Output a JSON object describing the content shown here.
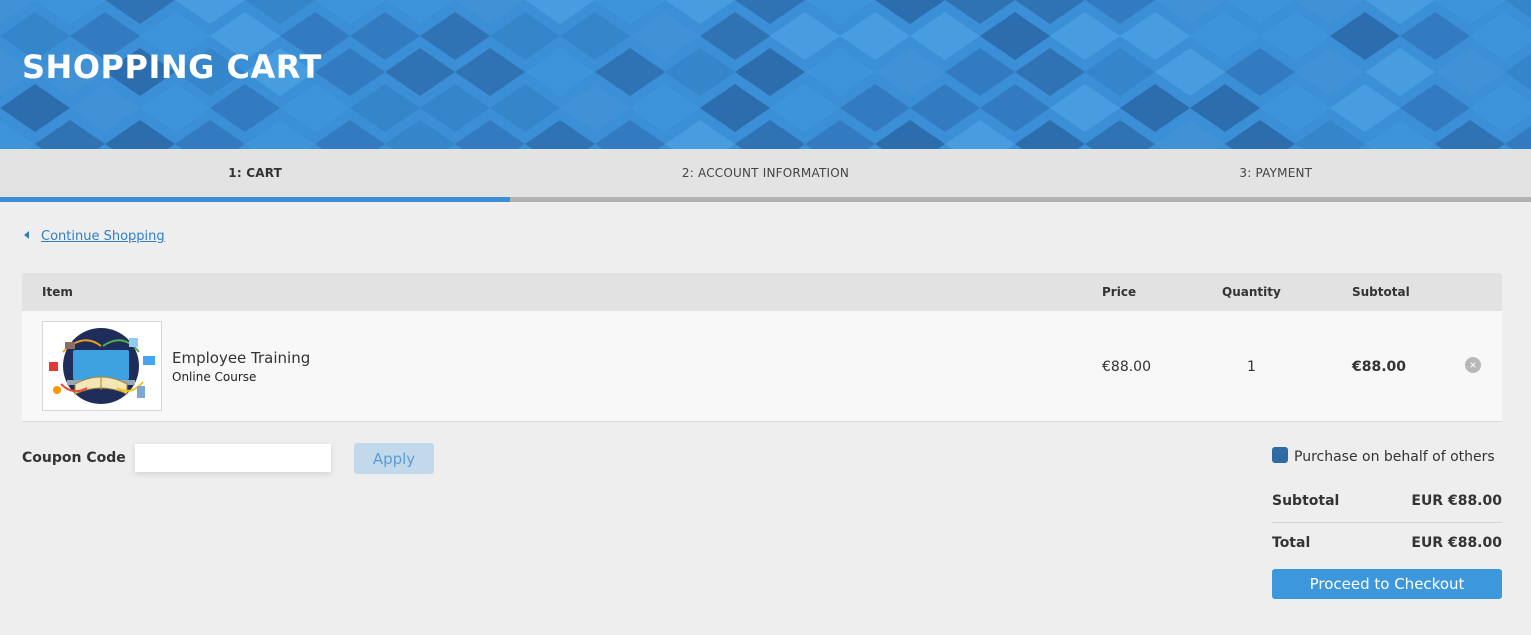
{
  "header": {
    "title": "SHOPPING CART"
  },
  "steps": [
    {
      "label": "1: CART",
      "active": true
    },
    {
      "label": "2: ACCOUNT INFORMATION",
      "active": false
    },
    {
      "label": "3: PAYMENT",
      "active": false
    }
  ],
  "progress": {
    "fraction": 0.3333
  },
  "continue_shopping": {
    "label": "Continue Shopping"
  },
  "table": {
    "headers": {
      "item": "Item",
      "price": "Price",
      "quantity": "Quantity",
      "subtotal": "Subtotal"
    },
    "rows": [
      {
        "name": "Employee Training",
        "type": "Online Course",
        "price": "€88.00",
        "quantity": "1",
        "subtotal": "€88.00"
      }
    ]
  },
  "coupon": {
    "label": "Coupon Code",
    "value": "",
    "placeholder": "",
    "apply_label": "Apply"
  },
  "summary": {
    "behalf_label": "Purchase on behalf of others",
    "subtotal_label": "Subtotal",
    "subtotal_value": "EUR €88.00",
    "total_label": "Total",
    "total_value": "EUR €88.00",
    "checkout_label": "Proceed to Checkout"
  },
  "colors": {
    "accent": "#3a8fd6",
    "checkout": "#3d97dc",
    "checkbox": "#2e6aa4"
  },
  "icons": {
    "back": "caret-left-icon",
    "remove": "remove-circle-icon"
  }
}
